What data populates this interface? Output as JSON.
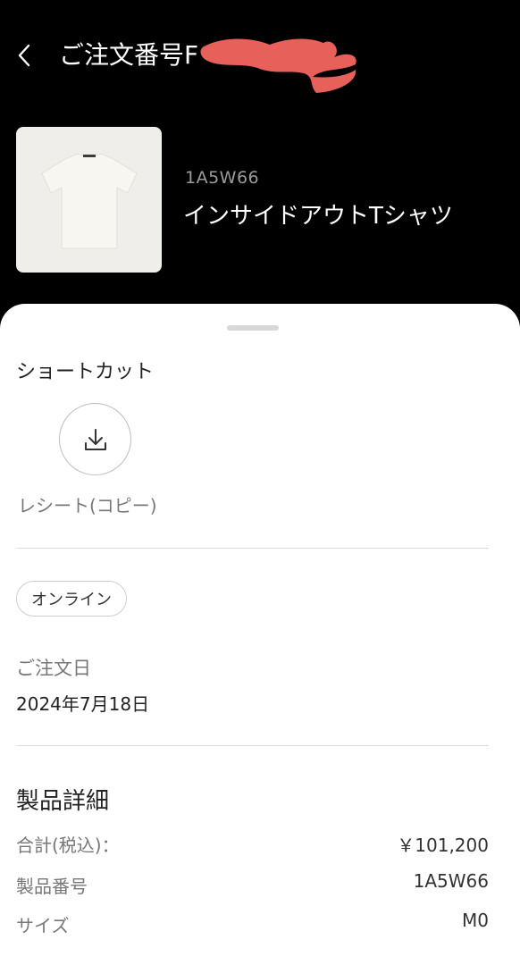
{
  "header": {
    "back_icon": "chevron-left-icon",
    "title": "ご注文番号F"
  },
  "product": {
    "sku": "1A5W66",
    "name": "インサイドアウトTシャツ"
  },
  "shortcuts": {
    "title": "ショートカット",
    "download_icon": "download-icon",
    "receipt_label": "レシート(コピー)"
  },
  "order": {
    "channel_badge": "オンライン",
    "date_label": "ご注文日",
    "date_value": "2024年7月18日"
  },
  "details": {
    "title": "製品詳細",
    "rows": [
      {
        "label": "合計(税込)：",
        "value": "￥101,200"
      },
      {
        "label": "製品番号",
        "value": "1A5W66"
      },
      {
        "label": "サイズ",
        "value": "M0"
      }
    ]
  },
  "colors": {
    "header_bg": "#000000",
    "sheet_bg": "#ffffff",
    "redaction": "#e8605a"
  }
}
